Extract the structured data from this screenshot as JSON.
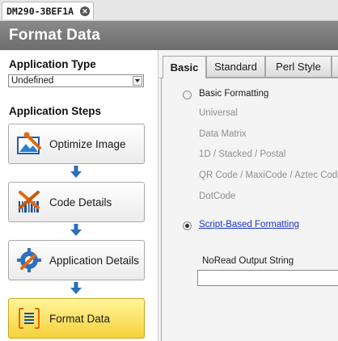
{
  "document_tab": {
    "label": "DM290-3BEF1A",
    "close_icon": "close-icon"
  },
  "title_bar": {
    "title": "Format Data"
  },
  "left": {
    "application_type_label": "Application Type",
    "application_type_value": "Undefined",
    "application_steps_label": "Application Steps",
    "steps": [
      {
        "label": "Optimize Image",
        "icon": "optimize-image-icon"
      },
      {
        "label": "Code Details",
        "icon": "code-details-icon"
      },
      {
        "label": "Application Details",
        "icon": "application-details-icon"
      },
      {
        "label": "Format Data",
        "icon": "format-data-icon",
        "active": true
      }
    ]
  },
  "right": {
    "tabs": [
      {
        "label": "Basic",
        "active": true
      },
      {
        "label": "Standard"
      },
      {
        "label": "Perl Style"
      }
    ],
    "basic_formatting_label": "Basic Formatting",
    "basic_options": [
      "Universal",
      "Data Matrix",
      "1D / Stacked / Postal",
      "QR Code / MaxiCode / Aztec Code",
      "DotCode"
    ],
    "script_formatting_label": "Script-Based Formatting",
    "selected_mode": "Script-Based Formatting",
    "noread_label": "NoRead Output String",
    "noread_value": ""
  },
  "colors": {
    "title_bar": "#787878",
    "active_step": "#f6d23a",
    "link": "#1a33c8",
    "disabled_text": "#8e8e8e"
  }
}
